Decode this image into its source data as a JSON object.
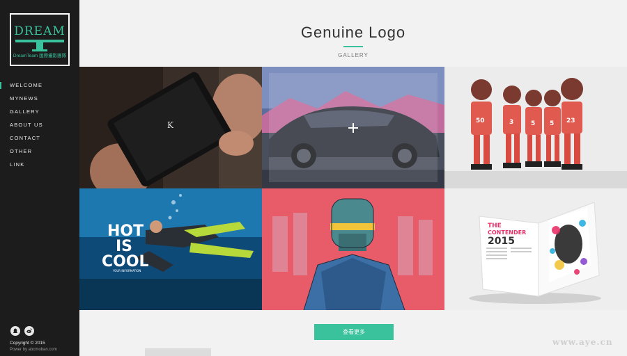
{
  "sidebar": {
    "logo": {
      "title": "DREAM",
      "subtitle": "DreamTeam 国際攝影團隊"
    },
    "nav": [
      {
        "label": "WELCOME",
        "active": true
      },
      {
        "label": "MYNEWS",
        "active": false
      },
      {
        "label": "GALLERY",
        "active": false
      },
      {
        "label": "ABOUT US",
        "active": false
      },
      {
        "label": "CONTACT",
        "active": false
      },
      {
        "label": "OTHER",
        "active": false
      },
      {
        "label": "LINK",
        "active": false
      }
    ],
    "social": [
      "qq-icon",
      "weibo-icon"
    ],
    "copyright": "Copyright © 2015",
    "powered": "Power by abcmoban.com"
  },
  "header": {
    "title": "Genuine Logo",
    "section": "GALLERY"
  },
  "gallery": {
    "tiles": [
      {
        "name": "tablet-photo",
        "tablet_text": "K"
      },
      {
        "name": "car-photo",
        "hover_icon": "plus-icon"
      },
      {
        "name": "figurines-photo",
        "jerseys": [
          "50",
          "3",
          "5",
          "5",
          "23"
        ]
      },
      {
        "name": "diver-poster",
        "headline": [
          "HOT",
          "IS",
          "COOL"
        ],
        "caption": "YOUR INFORMATION"
      },
      {
        "name": "cyborg-illustration"
      },
      {
        "name": "magazine-photo",
        "headline": [
          "THE",
          "CONTENDER",
          "2015"
        ]
      }
    ],
    "more_label": "查看更多"
  },
  "watermark": "www.aye.cn",
  "colors": {
    "accent": "#39c29b",
    "sidebar": "#1c1c1c",
    "page": "#f2f2f2"
  }
}
